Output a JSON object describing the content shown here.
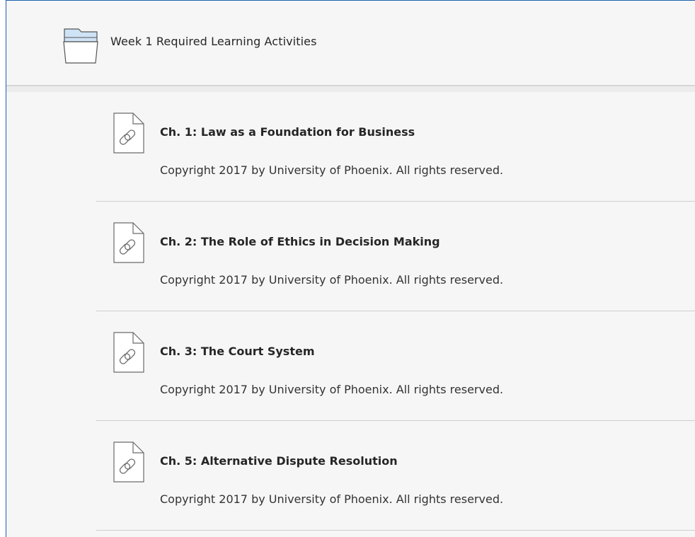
{
  "folder": {
    "title": "Week 1 Required Learning Activities",
    "icon": "folder-open-icon"
  },
  "items": [
    {
      "title": "Ch. 1: Law as a Foundation for Business",
      "description": "Copyright 2017 by University of Phoenix. All rights reserved.",
      "icon": "web-link-document-icon"
    },
    {
      "title": "Ch. 2: The Role of Ethics in Decision Making",
      "description": "Copyright 2017 by University of Phoenix. All rights reserved.",
      "icon": "web-link-document-icon"
    },
    {
      "title": "Ch. 3: The Court System",
      "description": "Copyright 2017 by University of Phoenix. All rights reserved.",
      "icon": "web-link-document-icon"
    },
    {
      "title": "Ch. 5: Alternative Dispute Resolution",
      "description": "Copyright 2017 by University of Phoenix. All rights reserved.",
      "icon": "web-link-document-icon"
    }
  ],
  "colors": {
    "frame_border": "#1f62b0",
    "background": "#f6f6f6",
    "divider": "#cfcfcf",
    "folder_tab": "#cfe3f6"
  }
}
